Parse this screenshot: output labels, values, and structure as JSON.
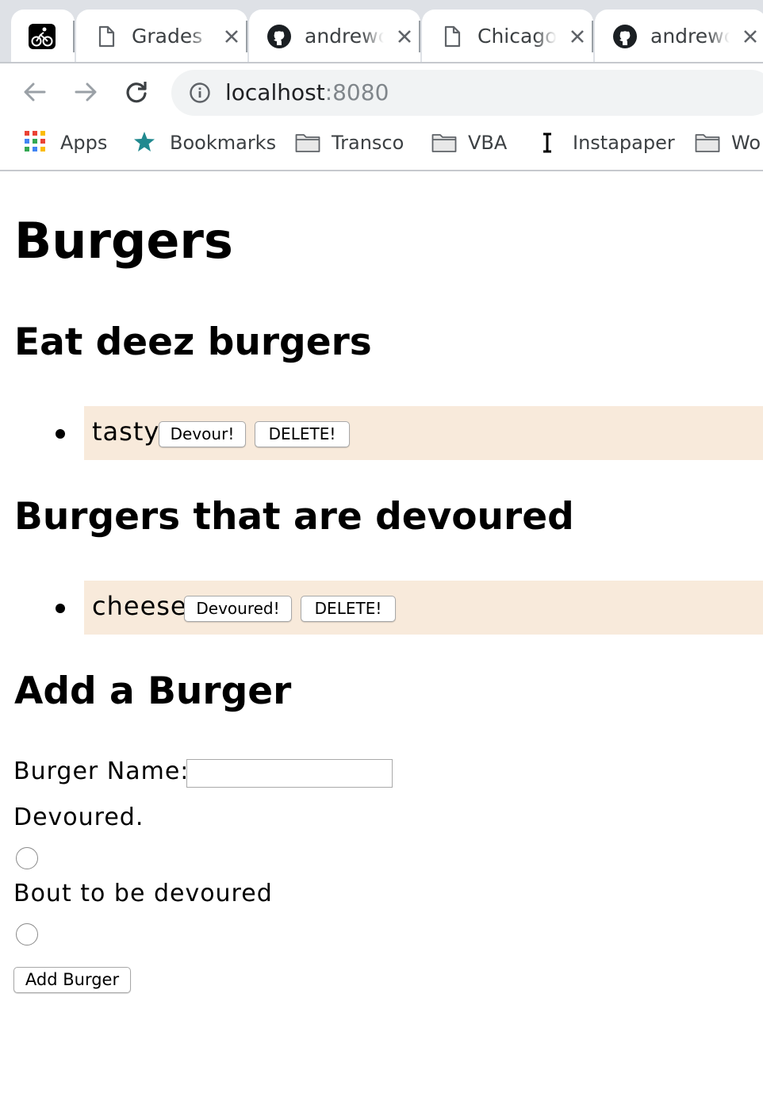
{
  "browser": {
    "tabs": [
      {
        "title": "Grades",
        "icon": "document-icon"
      },
      {
        "title": "andrewc",
        "icon": "github-icon"
      },
      {
        "title": "Chicago",
        "icon": "document-icon"
      },
      {
        "title": "andrewc",
        "icon": "github-icon"
      }
    ],
    "pinned_tab_icon": "cyclist-icon",
    "url_host": "localhost",
    "url_port": ":8080",
    "bookmarks": [
      {
        "label": "Apps",
        "icon": "apps-grid-icon"
      },
      {
        "label": "Bookmarks",
        "icon": "star-icon"
      },
      {
        "label": "Transco",
        "icon": "folder-icon"
      },
      {
        "label": "VBA",
        "icon": "folder-icon"
      },
      {
        "label": "Instapaper",
        "icon": "instapaper-icon"
      },
      {
        "label": "Wo",
        "icon": "folder-icon"
      }
    ]
  },
  "page": {
    "title": "Burgers",
    "uneaten_heading": "Eat deez burgers",
    "uneaten": [
      {
        "name": "tasty",
        "action_label": "Devour!",
        "delete_label": "DELETE!"
      }
    ],
    "devoured_heading": "Burgers that are devoured",
    "devoured": [
      {
        "name": "cheese",
        "action_label": "Devoured!",
        "delete_label": "DELETE!"
      }
    ],
    "form": {
      "heading": "Add a Burger",
      "name_label": "Burger Name:",
      "name_value": "",
      "option_devoured": "Devoured.",
      "option_not_devoured": "Bout to be devoured",
      "submit_label": "Add Burger"
    },
    "colors": {
      "item_background": "#f8eadb"
    }
  }
}
